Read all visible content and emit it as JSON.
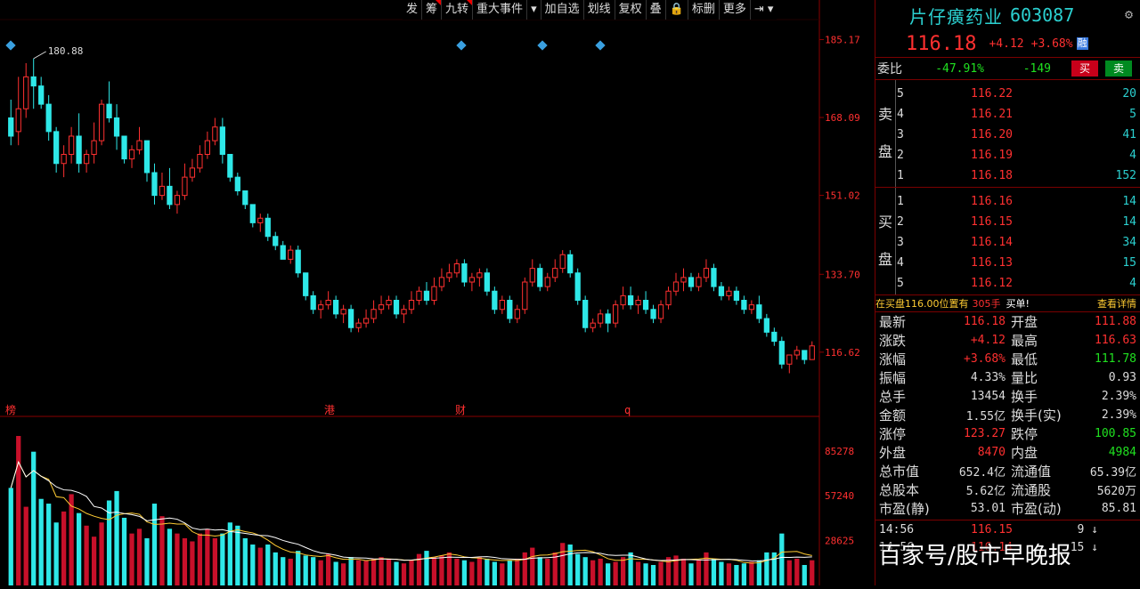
{
  "toolbar": {
    "items": [
      {
        "label": "发",
        "marked": false
      },
      {
        "label": "筹",
        "marked": true
      },
      {
        "label": "九转",
        "marked": true
      },
      {
        "label": "重大事件",
        "marked": false
      },
      {
        "label": "▾",
        "marked": false
      },
      {
        "label": "加自选",
        "marked": false
      },
      {
        "label": "划线",
        "marked": false
      },
      {
        "label": "复权",
        "marked": false
      },
      {
        "label": "叠",
        "marked": false
      },
      {
        "label": "🔒",
        "marked": false
      },
      {
        "label": "标删",
        "marked": false
      },
      {
        "label": "更多",
        "marked": false
      },
      {
        "label": "⇥ ▾",
        "marked": false
      }
    ]
  },
  "chart_data": {
    "type": "candlestick",
    "price_axis": [
      "185.17",
      "168.09",
      "151.02",
      "133.70",
      "116.62"
    ],
    "price_range": [
      108,
      188
    ],
    "max_label": "180.88",
    "event_markers": [
      "榜",
      "港",
      "财",
      "q"
    ],
    "volume_axis": [
      "85278",
      "57240",
      "28625"
    ],
    "volume_range": [
      0,
      95000
    ],
    "ohlc": [
      [
        168,
        172,
        164,
        162
      ],
      [
        165,
        177,
        170,
        162
      ],
      [
        170,
        180,
        177,
        168
      ],
      [
        177,
        181,
        175,
        170
      ],
      [
        175,
        177,
        171,
        170
      ],
      [
        171,
        173,
        165,
        163
      ],
      [
        165,
        166,
        158,
        156
      ],
      [
        158,
        162,
        160,
        155
      ],
      [
        160,
        166,
        164,
        158
      ],
      [
        164,
        169,
        158,
        156
      ],
      [
        158,
        161,
        160,
        156
      ],
      [
        160,
        167,
        163,
        158
      ],
      [
        163,
        172,
        171,
        162
      ],
      [
        171,
        176,
        168,
        167
      ],
      [
        168,
        171,
        164,
        161
      ],
      [
        164,
        164,
        159,
        158
      ],
      [
        159,
        162,
        161,
        157
      ],
      [
        161,
        166,
        163,
        160
      ],
      [
        163,
        163,
        156,
        154
      ],
      [
        156,
        158,
        151,
        149
      ],
      [
        151,
        156,
        153,
        150
      ],
      [
        153,
        157,
        149,
        148
      ],
      [
        149,
        152,
        151,
        147
      ],
      [
        151,
        158,
        155,
        150
      ],
      [
        155,
        159,
        157,
        154
      ],
      [
        157,
        162,
        160,
        156
      ],
      [
        160,
        165,
        163,
        159
      ],
      [
        163,
        168,
        166,
        162
      ],
      [
        166,
        168,
        160,
        158
      ],
      [
        160,
        160,
        155,
        154
      ],
      [
        155,
        156,
        152,
        151
      ],
      [
        152,
        152,
        149,
        148
      ],
      [
        149,
        149,
        145,
        144
      ],
      [
        145,
        147,
        146,
        143
      ],
      [
        146,
        147,
        142,
        141
      ],
      [
        142,
        143,
        140,
        139
      ],
      [
        140,
        141,
        137,
        137
      ],
      [
        137,
        140,
        139,
        136
      ],
      [
        139,
        140,
        134,
        133
      ],
      [
        134,
        134,
        129,
        128
      ],
      [
        129,
        130,
        126,
        125
      ],
      [
        126,
        128,
        127,
        124
      ],
      [
        127,
        130,
        128,
        126
      ],
      [
        128,
        129,
        125,
        124
      ],
      [
        125,
        127,
        126,
        123
      ],
      [
        126,
        127,
        122,
        121
      ],
      [
        122,
        124,
        123,
        121
      ],
      [
        123,
        126,
        124,
        122
      ],
      [
        124,
        128,
        126,
        123
      ],
      [
        126,
        129,
        127,
        125
      ],
      [
        127,
        129,
        128,
        126
      ],
      [
        128,
        129,
        125,
        124
      ],
      [
        125,
        127,
        126,
        123
      ],
      [
        126,
        130,
        128,
        125
      ],
      [
        128,
        131,
        130,
        127
      ],
      [
        130,
        132,
        128,
        127
      ],
      [
        128,
        133,
        131,
        127
      ],
      [
        131,
        135,
        133,
        130
      ],
      [
        133,
        136,
        134,
        132
      ],
      [
        134,
        137,
        136,
        133
      ],
      [
        136,
        137,
        132,
        131
      ],
      [
        132,
        134,
        133,
        130
      ],
      [
        133,
        135,
        134,
        131
      ],
      [
        134,
        135,
        130,
        129
      ],
      [
        130,
        131,
        126,
        125
      ],
      [
        126,
        129,
        128,
        125
      ],
      [
        128,
        129,
        124,
        123
      ],
      [
        124,
        127,
        126,
        123
      ],
      [
        126,
        133,
        132,
        125
      ],
      [
        132,
        137,
        135,
        131
      ],
      [
        135,
        136,
        131,
        130
      ],
      [
        131,
        134,
        133,
        130
      ],
      [
        133,
        137,
        135,
        132
      ],
      [
        135,
        139,
        138,
        134
      ],
      [
        138,
        139,
        134,
        133
      ],
      [
        134,
        135,
        128,
        127
      ],
      [
        128,
        129,
        122,
        121
      ],
      [
        122,
        124,
        123,
        121
      ],
      [
        123,
        126,
        125,
        122
      ],
      [
        125,
        126,
        123,
        121
      ],
      [
        123,
        128,
        127,
        122
      ],
      [
        127,
        131,
        129,
        126
      ],
      [
        129,
        131,
        127,
        126
      ],
      [
        127,
        129,
        128,
        125
      ],
      [
        128,
        130,
        126,
        125
      ],
      [
        126,
        127,
        124,
        123
      ],
      [
        124,
        128,
        127,
        123
      ],
      [
        127,
        131,
        130,
        126
      ],
      [
        130,
        134,
        132,
        129
      ],
      [
        132,
        135,
        133,
        130
      ],
      [
        133,
        134,
        131,
        130
      ],
      [
        131,
        134,
        133,
        130
      ],
      [
        133,
        137,
        135,
        132
      ],
      [
        135,
        136,
        131,
        130
      ],
      [
        131,
        132,
        129,
        128
      ],
      [
        129,
        131,
        130,
        128
      ],
      [
        130,
        131,
        128,
        127
      ],
      [
        128,
        129,
        126,
        125
      ],
      [
        126,
        128,
        127,
        125
      ],
      [
        127,
        129,
        124,
        123
      ],
      [
        124,
        125,
        121,
        120
      ],
      [
        121,
        122,
        119,
        118
      ],
      [
        119,
        120,
        114,
        113
      ],
      [
        114,
        116,
        116,
        112
      ],
      [
        116,
        118,
        117,
        115
      ],
      [
        117,
        117,
        115,
        114
      ],
      [
        115,
        119,
        118,
        115
      ]
    ],
    "volumes": [
      62000,
      95000,
      50000,
      85000,
      55000,
      52000,
      40000,
      47000,
      58000,
      46000,
      38000,
      31000,
      40000,
      54000,
      60000,
      43000,
      33000,
      36000,
      30000,
      52000,
      44000,
      36000,
      33000,
      30000,
      28000,
      33000,
      36000,
      30000,
      33000,
      40000,
      38000,
      30000,
      26000,
      24000,
      26000,
      21000,
      18000,
      17000,
      22000,
      19000,
      18000,
      16000,
      20000,
      15000,
      14000,
      18000,
      16000,
      16000,
      17000,
      18000,
      17000,
      15000,
      14000,
      16000,
      20000,
      22000,
      18000,
      19000,
      21000,
      17000,
      16000,
      15000,
      18000,
      17000,
      15000,
      14000,
      16000,
      17000,
      21000,
      24000,
      18000,
      17000,
      21000,
      27000,
      26000,
      20000,
      18000,
      16000,
      17000,
      14000,
      15000,
      18000,
      21000,
      15000,
      14000,
      13000,
      15000,
      18000,
      19000,
      17000,
      14000,
      16000,
      21000,
      17000,
      15000,
      14000,
      13000,
      14000,
      15000,
      16000,
      21000,
      21000,
      33000,
      16000,
      17000,
      13000,
      16000
    ]
  },
  "stock": {
    "name": "片仔癀药业",
    "name_shown": "片仔癀药业",
    "code": "603087",
    "last": "116.18",
    "change": "+4.12",
    "change_pct": "+3.68%",
    "rong": "融"
  },
  "ratio": {
    "label": "委比",
    "pct": "-47.91%",
    "diff": "-149",
    "buy_label": "买",
    "sell_label": "卖"
  },
  "ask": {
    "side_top": "卖",
    "side_bottom": "盘",
    "rows": [
      {
        "lvl": "5",
        "px": "116.22",
        "vol": "20"
      },
      {
        "lvl": "4",
        "px": "116.21",
        "vol": "5"
      },
      {
        "lvl": "3",
        "px": "116.20",
        "vol": "41"
      },
      {
        "lvl": "2",
        "px": "116.19",
        "vol": "4"
      },
      {
        "lvl": "1",
        "px": "116.18",
        "vol": "152"
      }
    ]
  },
  "bid": {
    "side_top": "买",
    "side_bottom": "盘",
    "rows": [
      {
        "lvl": "1",
        "px": "116.16",
        "vol": "14"
      },
      {
        "lvl": "2",
        "px": "116.15",
        "vol": "14"
      },
      {
        "lvl": "3",
        "px": "116.14",
        "vol": "34"
      },
      {
        "lvl": "4",
        "px": "116.13",
        "vol": "15"
      },
      {
        "lvl": "5",
        "px": "116.12",
        "vol": "4"
      }
    ]
  },
  "tip": {
    "text": "在买盘116.00位置有",
    "hands": "305手",
    "buy": "买单!",
    "link": "查看详情"
  },
  "quote": {
    "rows": [
      {
        "l1": "最新",
        "v1": "116.18",
        "c1": "red",
        "l2": "开盘",
        "v2": "111.88",
        "c2": "red"
      },
      {
        "l1": "涨跌",
        "v1": "+4.12",
        "c1": "red",
        "l2": "最高",
        "v2": "116.63",
        "c2": "red"
      },
      {
        "l1": "涨幅",
        "v1": "+3.68%",
        "c1": "red",
        "l2": "最低",
        "v2": "111.78",
        "c2": "green"
      },
      {
        "l1": "振幅",
        "v1": "4.33%",
        "c1": "white",
        "l2": "量比",
        "v2": "0.93",
        "c2": "white"
      },
      {
        "l1": "总手",
        "v1": "13454",
        "c1": "white",
        "l2": "换手",
        "v2": "2.39%",
        "c2": "white"
      },
      {
        "l1": "金额",
        "v1": "1.55亿",
        "c1": "white",
        "l2": "换手(实)",
        "v2": "2.39%",
        "c2": "white"
      },
      {
        "l1": "涨停",
        "v1": "123.27",
        "c1": "red",
        "l2": "跌停",
        "v2": "100.85",
        "c2": "green"
      },
      {
        "l1": "外盘",
        "v1": "8470",
        "c1": "red",
        "l2": "内盘",
        "v2": "4984",
        "c2": "green"
      },
      {
        "l1": "总市值",
        "v1": "652.4亿",
        "c1": "white",
        "l2": "流通值",
        "v2": "65.39亿",
        "c2": "white"
      },
      {
        "l1": "总股本",
        "v1": "5.62亿",
        "c1": "white",
        "l2": "流通股",
        "v2": "5620万",
        "c2": "white"
      },
      {
        "l1": "市盈(静)",
        "v1": "53.01",
        "c1": "white",
        "l2": "市盈(动)",
        "v2": "85.81",
        "c2": "white"
      }
    ]
  },
  "ticks": [
    {
      "time": "14:56",
      "px": "116.15",
      "vol": "9 ↓"
    },
    {
      "time": "14:56",
      "px": "116.14",
      "vol": "15 ↓"
    }
  ],
  "watermark": "百家号/股市早晚报",
  "colors": {
    "up": "#ff3030",
    "down": "#2ee8e8",
    "ma": "#ffcc33"
  }
}
